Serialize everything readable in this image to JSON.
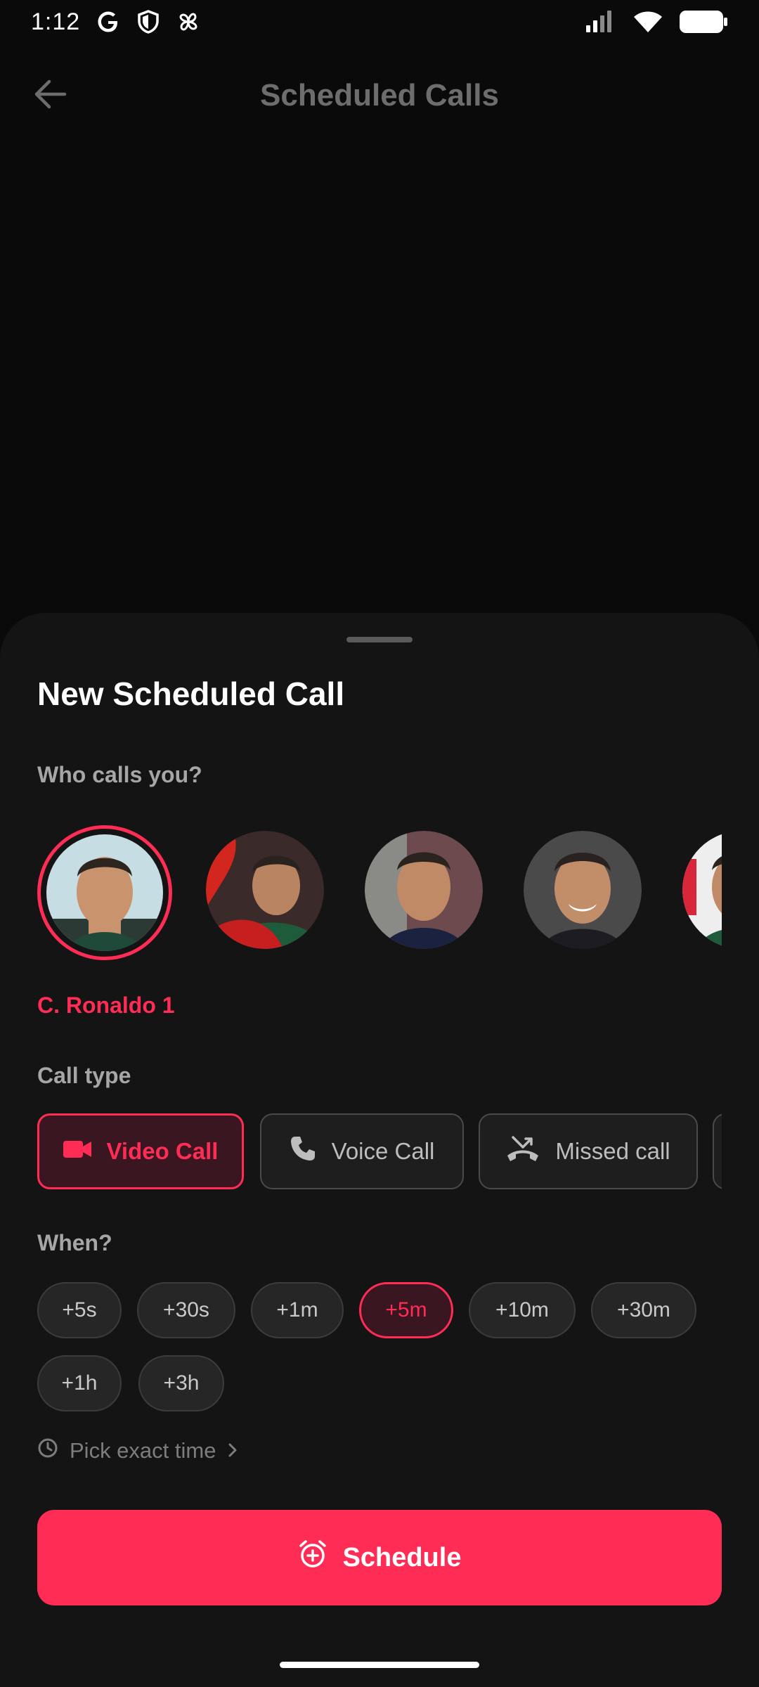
{
  "status_bar": {
    "time": "1:12",
    "left_icons": [
      "google-g-icon",
      "shield-icon",
      "pinwheel-icon"
    ],
    "right_icons": [
      "signal-icon",
      "wifi-icon",
      "battery-icon"
    ]
  },
  "app_bar": {
    "title": "Scheduled Calls",
    "back_icon": "arrow-left-icon"
  },
  "sheet": {
    "title": "New Scheduled Call",
    "who_label": "Who calls you?",
    "contacts": [
      {
        "name": "C. Ronaldo 1",
        "selected": true
      },
      {
        "selected": false
      },
      {
        "selected": false
      },
      {
        "selected": false
      },
      {
        "selected": false
      }
    ],
    "selected_contact_name": "C. Ronaldo 1",
    "call_type_label": "Call type",
    "call_types": [
      {
        "label": "Video Call",
        "icon": "video-camera-icon",
        "selected": true
      },
      {
        "label": "Voice Call",
        "icon": "phone-icon",
        "selected": false
      },
      {
        "label": "Missed call",
        "icon": "missed-call-icon",
        "selected": false
      }
    ],
    "when_label": "When?",
    "time_options": [
      {
        "label": "+5s",
        "selected": false
      },
      {
        "label": "+30s",
        "selected": false
      },
      {
        "label": "+1m",
        "selected": false
      },
      {
        "label": "+5m",
        "selected": true
      },
      {
        "label": "+10m",
        "selected": false
      },
      {
        "label": "+30m",
        "selected": false
      },
      {
        "label": "+1h",
        "selected": false
      },
      {
        "label": "+3h",
        "selected": false
      }
    ],
    "pick_exact_time": "Pick exact time",
    "schedule_label": "Schedule"
  },
  "colors": {
    "accent": "#ff2d55",
    "background": "#0a0a0a",
    "sheet": "#141414"
  }
}
